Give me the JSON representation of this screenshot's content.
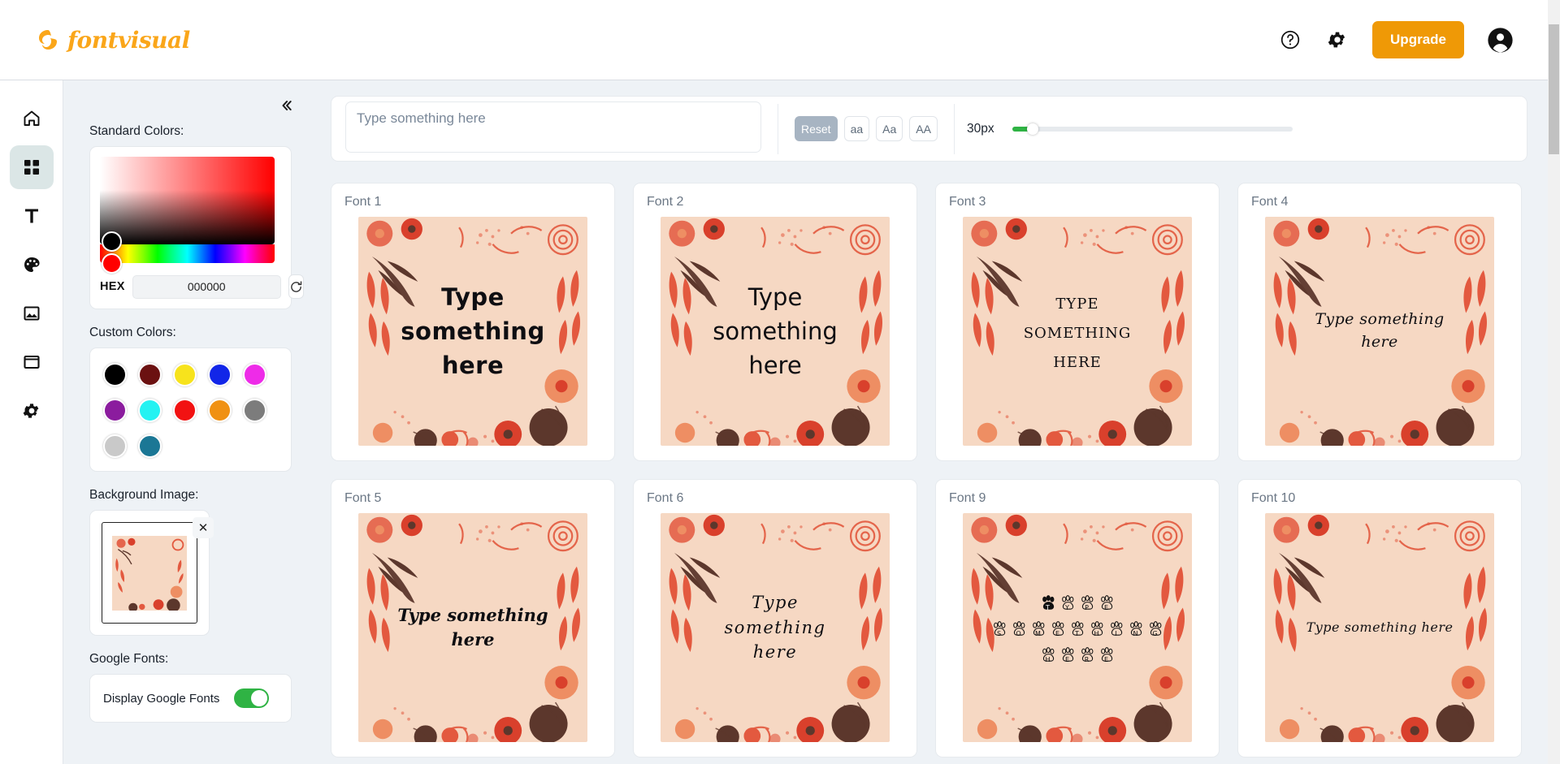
{
  "app": {
    "logo_text": "fontvisual",
    "brand_color": "#FAA61A"
  },
  "topbar": {
    "help_icon": "help-circle-icon",
    "settings_icon": "gear-icon",
    "upgrade_label": "Upgrade",
    "upgrade_color": "#EF9906",
    "account_icon": "account-circle-icon"
  },
  "rail": {
    "items": [
      {
        "name": "home",
        "icon": "home-icon",
        "active": false
      },
      {
        "name": "templates",
        "icon": "grid-icon",
        "active": true
      },
      {
        "name": "text",
        "icon": "text-icon",
        "active": false
      },
      {
        "name": "colors",
        "icon": "palette-icon",
        "active": false
      },
      {
        "name": "images",
        "icon": "image-icon",
        "active": false
      },
      {
        "name": "frames",
        "icon": "window-icon",
        "active": false
      },
      {
        "name": "settings",
        "icon": "gear-icon",
        "active": false
      }
    ]
  },
  "panel": {
    "collapse_icon": "chevron-double-left-icon",
    "standard_colors_label": "Standard Colors:",
    "hex_label": "HEX",
    "hex_value": "000000",
    "refresh_icon": "refresh-icon",
    "custom_colors_label": "Custom Colors:",
    "custom_colors": [
      "#000000",
      "#6B1111",
      "#F7E31C",
      "#1226E8",
      "#EE2BE8",
      "#8B1C9E",
      "#24F2F2",
      "#F21212",
      "#F09113",
      "#7C7C7C",
      "#C9C9C9",
      "#1B7795"
    ],
    "background_image_label": "Background Image:",
    "thumb_remove_icon": "close-icon",
    "google_fonts_label": "Google Fonts:",
    "display_google_fonts_label": "Display Google Fonts",
    "display_google_fonts_on": true,
    "toggle_on_color": "#2fb344"
  },
  "toolbar": {
    "input_placeholder": "Type something here",
    "input_value": "",
    "case_buttons": [
      {
        "label": "Reset",
        "active": true
      },
      {
        "label": "aa",
        "active": false
      },
      {
        "label": "Aa",
        "active": false
      },
      {
        "label": "AA",
        "active": false
      }
    ],
    "size_value": "30px",
    "slider_percent": 7,
    "slider_color": "#2fb344"
  },
  "preview": {
    "sample_text": "Type something here",
    "bg_base_color": "#F6D8C3",
    "flower_color": "#E3593F",
    "flower_light": "#EE8E63",
    "stem_color": "#5C372C"
  },
  "cards": [
    {
      "label": "Font 1",
      "style": "pv-f1",
      "lines": [
        "Type",
        "something",
        "here"
      ]
    },
    {
      "label": "Font 2",
      "style": "pv-f2",
      "lines": [
        "Type",
        "something",
        "here"
      ]
    },
    {
      "label": "Font 3",
      "style": "pv-f3",
      "lines": [
        "Type",
        "something",
        "here"
      ]
    },
    {
      "label": "Font 4",
      "style": "pv-f4",
      "lines": [
        "Type something",
        "here"
      ]
    },
    {
      "label": "Font 5",
      "style": "pv-f5",
      "lines": [
        "Type something",
        "here"
      ]
    },
    {
      "label": "Font 6",
      "style": "pv-f6",
      "lines": [
        "Type  something",
        "here"
      ]
    },
    {
      "label": "Font 9",
      "style": "pv-f9",
      "paw_rows": [
        "TYPE",
        "SOMETHING",
        "HERE"
      ]
    },
    {
      "label": "Font 10",
      "style": "pv-f10",
      "lines": [
        "Type something here"
      ]
    }
  ]
}
